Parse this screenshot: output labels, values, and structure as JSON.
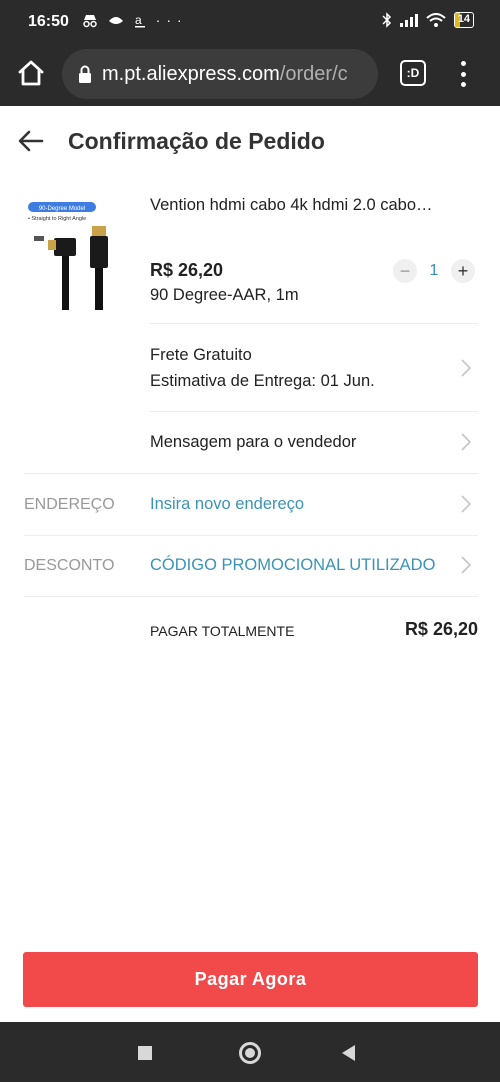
{
  "status_bar": {
    "time": "16:50",
    "left_icons": [
      "incognito-icon",
      "notification-icon",
      "amazon-icon"
    ],
    "more": "···",
    "battery": "14"
  },
  "browser": {
    "url_host": "m.pt.aliexpress.com",
    "url_path": "/order/c",
    "tabs_label": ":D"
  },
  "page": {
    "title": "Confirmação de Pedido"
  },
  "product": {
    "name": "Vention hdmi cabo 4k hdmi 2.0 cabo…",
    "price": "R$ 26,20",
    "variant": "90 Degree-AAR,  1m",
    "quantity": "1",
    "image_caption": "90-Degree Model",
    "image_subcaption": "• Straight to Right Angle"
  },
  "shipping": {
    "line1": "Frete Gratuito",
    "line2": "Estimativa de Entrega: 01 Jun."
  },
  "message": {
    "label": "Mensagem para o vendedor"
  },
  "address": {
    "label": "ENDEREÇO",
    "value": "Insira novo endereço"
  },
  "discount": {
    "label": "DESCONTO",
    "value": "CÓDIGO PROMOCIONAL UTILIZADO"
  },
  "total": {
    "label": "PAGAR TOTALMENTE",
    "value": "R$ 26,20"
  },
  "actions": {
    "pay_now": "Pagar Agora"
  },
  "colors": {
    "primary_button": "#f24a4a",
    "link": "#3a93b8",
    "system_bar": "#2b2b2b"
  }
}
